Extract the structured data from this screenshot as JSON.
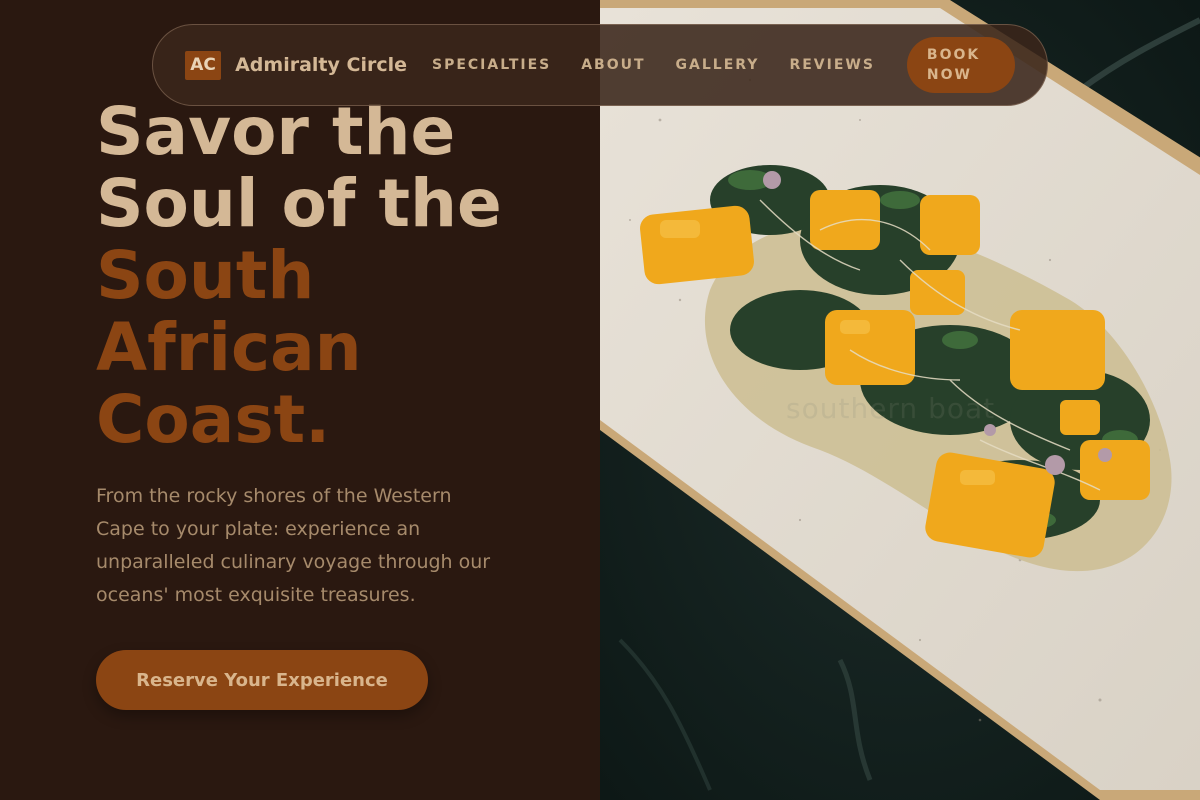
{
  "brand": {
    "logo_initials": "AC",
    "name": "Admiralty Circle"
  },
  "nav": {
    "links": [
      {
        "label": "SPECIALTIES"
      },
      {
        "label": "ABOUT"
      },
      {
        "label": "GALLERY"
      },
      {
        "label": "REVIEWS"
      }
    ],
    "book_button_line1": "BOOK",
    "book_button_line2": "NOW"
  },
  "hero": {
    "title_part1": "Savor the Soul of the",
    "title_accent": "South African Coast.",
    "description": "From the rocky shores of the Western Cape to your plate: experience an unparalleled culinary voyage through our oceans' most exquisite treasures.",
    "cta_label": "Reserve Your Experience"
  },
  "photo": {
    "subject": "dish-photo",
    "watermark": "southern boat"
  },
  "colors": {
    "background": "#2a1810",
    "accent": "#8b4513",
    "text_light": "#d4b896",
    "text_muted": "#a68a6b"
  }
}
